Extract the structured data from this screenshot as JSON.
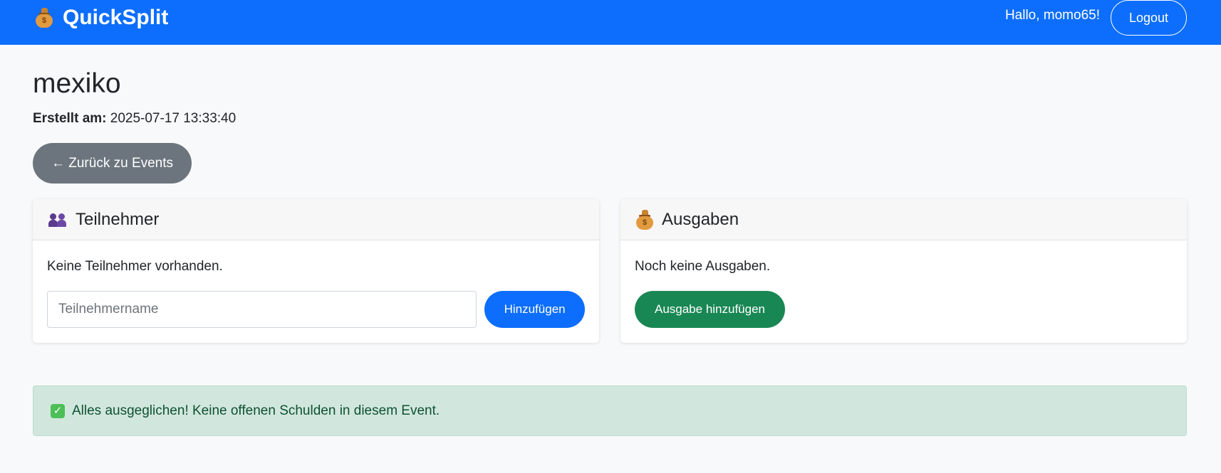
{
  "navbar": {
    "brand": "QuickSplit",
    "brand_icon": "money-bag-icon",
    "greeting": "Hallo, momo65!",
    "logout_label": "Logout",
    "bg_color": "#0d6efd"
  },
  "event": {
    "title": "mexiko",
    "created_label": "Erstellt am:",
    "created_value": "2025-07-17 13:33:40",
    "back_label": "← Zurück zu Events"
  },
  "participants": {
    "header": "Teilnehmer",
    "icon": "people-icon",
    "empty_text": "Keine Teilnehmer vorhanden.",
    "input_placeholder": "Teilnehmername",
    "add_label": "Hinzufügen"
  },
  "expenses": {
    "header": "Ausgaben",
    "icon": "money-bag-icon",
    "empty_text": "Noch keine Ausgaben.",
    "add_label": "Ausgabe hinzufügen"
  },
  "alert": {
    "icon": "check-icon",
    "text": "Alles ausgeglichen! Keine offenen Schulden in diesem Event.",
    "color": "#d1e7dd"
  }
}
